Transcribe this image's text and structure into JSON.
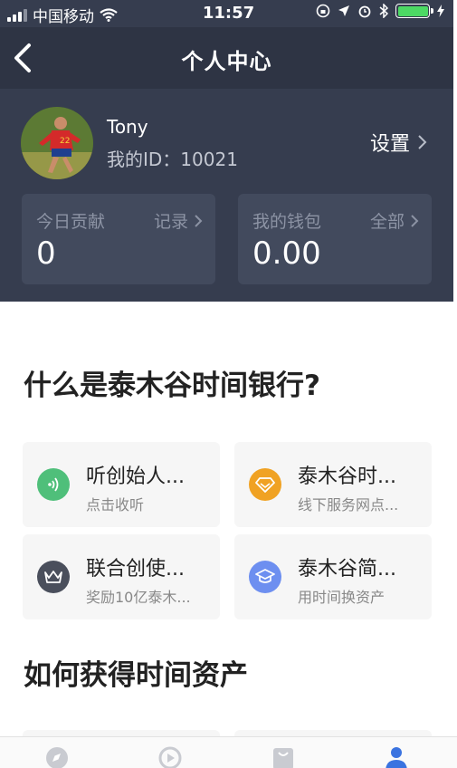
{
  "status_bar": {
    "carrier": "中国移动",
    "time": "11:57"
  },
  "nav": {
    "title": "个人中心"
  },
  "profile": {
    "name": "Tony",
    "id_line": "我的ID：10021",
    "settings_label": "设置"
  },
  "cards": [
    {
      "label": "今日贡献",
      "link": "记录",
      "value": "0"
    },
    {
      "label": "我的钱包",
      "link": "全部",
      "value": "0.00"
    }
  ],
  "section1": {
    "title": "什么是泰木谷时间银行?",
    "tiles": [
      {
        "title": "听创始人...",
        "subtitle": "点击收听",
        "icon": "audio-icon",
        "color": "#4fbf7a"
      },
      {
        "title": "泰木谷时...",
        "subtitle": "线下服务网点...",
        "icon": "diamond-icon",
        "color": "#f0a223"
      },
      {
        "title": "联合创使...",
        "subtitle": "奖励10亿泰木...",
        "icon": "crown-icon",
        "color": "#4a4f5c"
      },
      {
        "title": "泰木谷简...",
        "subtitle": "用时间换资产",
        "icon": "graduation-cap-icon",
        "color": "#6d8ff0"
      }
    ]
  },
  "section2": {
    "title": "如何获得时间资产"
  },
  "tabbar": {
    "tabs": [
      "compass-icon",
      "play-icon",
      "bag-icon",
      "profile-icon"
    ],
    "active_color": "#3a73e0"
  }
}
